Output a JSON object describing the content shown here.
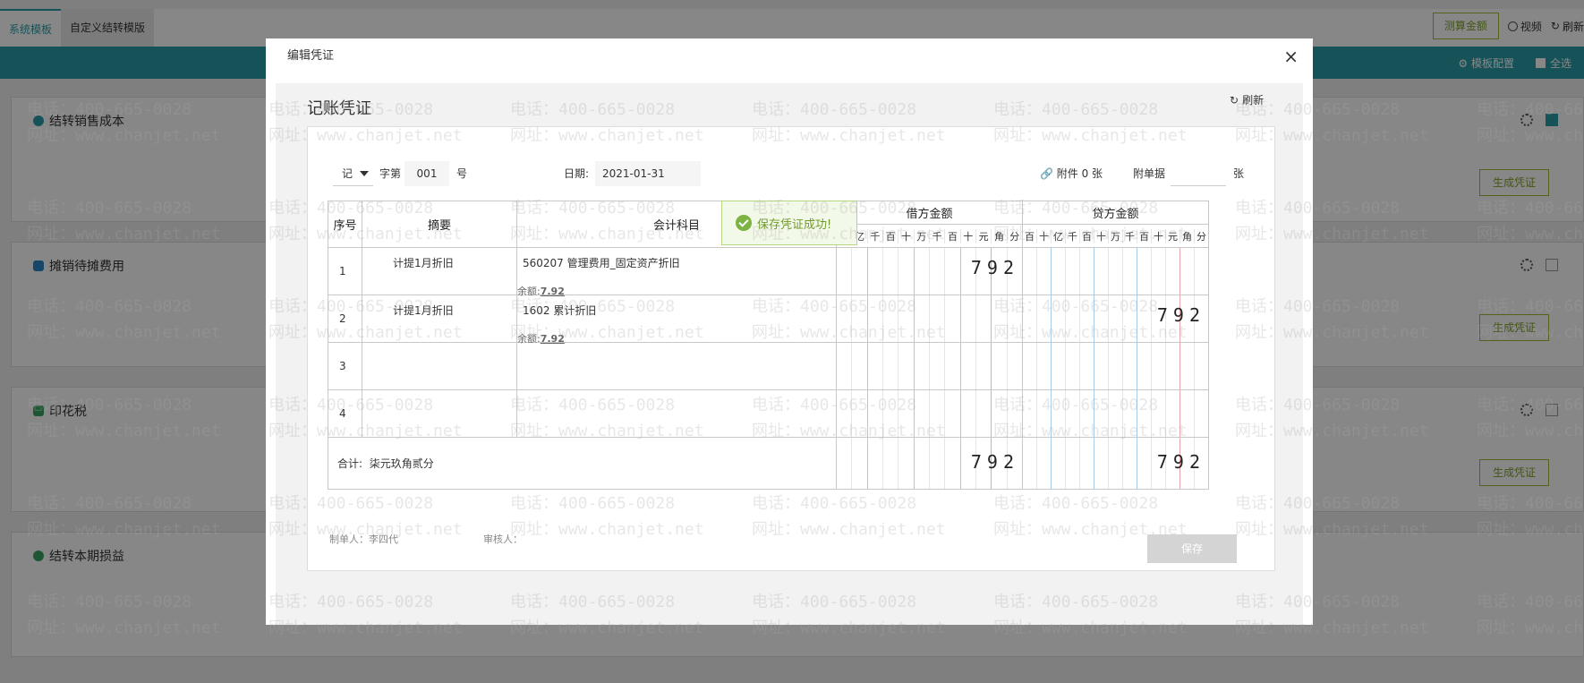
{
  "background": {
    "tabs": [
      {
        "label": "系统模板",
        "active": true
      },
      {
        "label": "自定义结转模版",
        "active": false
      }
    ],
    "calc_amount_label": "测算金额",
    "video_label": "视频",
    "refresh_label": "刷新",
    "template_config_label": "模板配置",
    "select_all_label": "全选",
    "generate_label": "生成凭证",
    "cards": [
      {
        "title": "结转销售成本",
        "icon_color": "#2b9ea9",
        "checked": true
      },
      {
        "title": "摊销待摊费用",
        "icon_color": "#2b86c4",
        "checked": false
      },
      {
        "title": "印花税",
        "icon_color": "#3aa361",
        "checked": false
      },
      {
        "title": "结转本期损益",
        "icon_color": "#3aa361",
        "checked": false
      }
    ]
  },
  "watermark": {
    "phone": "电话：400-665-0028",
    "site": "网址：www.chanjet.net"
  },
  "modal": {
    "title": "编辑凭证",
    "voucher_title": "记账凭证",
    "refresh_label": "刷新",
    "voucher_type": "记",
    "number_prefix": "字第",
    "number": "001",
    "number_suffix": "号",
    "date_label": "日期:",
    "date": "2021-01-31",
    "attachment_text": "附件 0 张",
    "attach_doc_label": "附单据",
    "attach_doc_value": "",
    "attach_unit": "张",
    "table": {
      "col_seq": "序号",
      "col_summary": "摘要",
      "col_subject": "会计科目",
      "col_debit": "借方金额",
      "col_credit": "贷方金额",
      "digit_units": [
        "千",
        "亿",
        "千",
        "百",
        "十",
        "万",
        "千",
        "百",
        "十",
        "元",
        "角",
        "分"
      ],
      "credit_digit_units": [
        "百",
        "十",
        "亿",
        "千",
        "百",
        "十",
        "万",
        "千",
        "百",
        "十",
        "元",
        "角",
        "分"
      ],
      "rows": [
        {
          "seq": "1",
          "summary": "计提1月折旧",
          "subject": "560207 管理费用_固定资产折旧",
          "balance_label": "余额:",
          "balance": "7.92",
          "debit": "792",
          "credit": ""
        },
        {
          "seq": "2",
          "summary": "计提1月折旧",
          "subject": "1602 累计折旧",
          "balance_label": "余额:",
          "balance": "7.92",
          "debit": "",
          "credit": "792"
        },
        {
          "seq": "3",
          "summary": "",
          "subject": "",
          "balance_label": "",
          "balance": "",
          "debit": "",
          "credit": ""
        },
        {
          "seq": "4",
          "summary": "",
          "subject": "",
          "balance_label": "",
          "balance": "",
          "debit": "",
          "credit": ""
        }
      ],
      "total_label": "合计:",
      "total_words": "柒元玖角贰分",
      "total_debit": "792",
      "total_credit": "792"
    },
    "maker_label": "制单人：李四代",
    "auditor_label": "审核人：",
    "save_label": "保存"
  },
  "toast": {
    "message": "保存凭证成功!"
  }
}
